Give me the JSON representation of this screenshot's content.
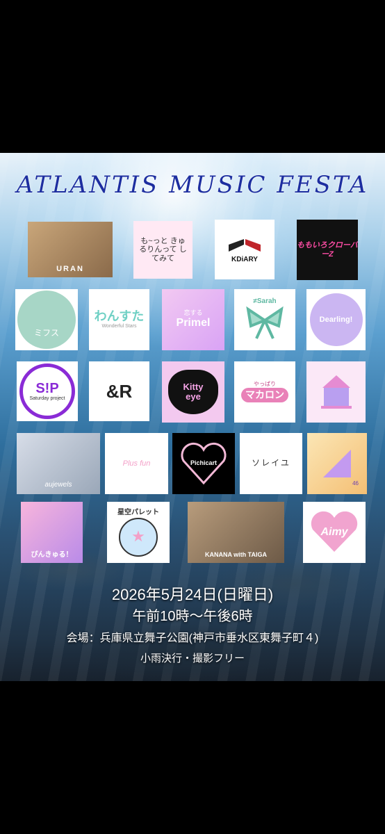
{
  "event": {
    "title": "ATLANTIS MUSIC FESTA",
    "date": "2026年5月24日(日曜日)",
    "time": "午前10時～午後6時",
    "venue": "会場：兵庫県立舞子公園(神戸市垂水区東舞子町４)",
    "note": "小雨決行・撮影フリー"
  },
  "performers": {
    "uran": "URAN",
    "motto": "も~っと きゅるりんって してみて",
    "kdiary": "KDiARY",
    "momoclo": "ももいろクローバーZ",
    "mofu": "ミフス",
    "wansuta": "わんすた",
    "wansuta_sub": "Wonderful Stars",
    "primel": "Primel",
    "primel_sub": "恋する",
    "sarah": "≠Sarah",
    "dearling": "Dearling!",
    "sp_logo": "S!P",
    "sp_name": "Saturday project",
    "andr": "&R",
    "kitty_top": "Kitty",
    "kitty_bottom": "eye",
    "macaron_top": "やっぱり",
    "macaron": "マカロン",
    "juwels": "aujewels",
    "plusfun": "Plus fun",
    "pichicart": "Pichicart",
    "soleil": "ソレイユ",
    "num46": "46",
    "pinkyu": "ぴんきゅる！",
    "hoshizora": "星空パレット",
    "kanana": "KANANA with TAIGA",
    "aimy": "Aimy"
  },
  "colors": {
    "title": "#1d2ea0",
    "pink": "#ff8fc8",
    "purple": "#8a2bd6",
    "mint": "#5fb8a2"
  }
}
